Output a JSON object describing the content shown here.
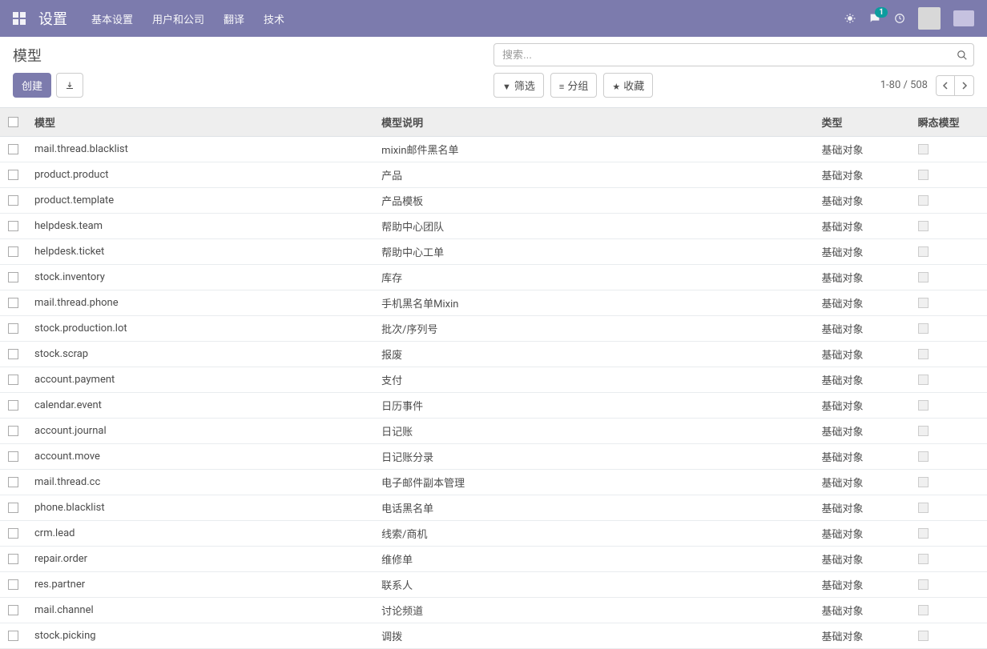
{
  "nav": {
    "title": "设置",
    "menu": [
      "基本设置",
      "用户和公司",
      "翻译",
      "技术"
    ],
    "msg_badge": "1"
  },
  "breadcrumb": "模型",
  "search": {
    "placeholder": "搜索..."
  },
  "buttons": {
    "create": "创建",
    "filter": "筛选",
    "group": "分组",
    "favorite": "收藏"
  },
  "pager": {
    "range": "1-80 / 508"
  },
  "table": {
    "headers": {
      "model": "模型",
      "desc": "模型说明",
      "type": "类型",
      "transient": "瞬态模型"
    },
    "rows": [
      {
        "model": "mail.thread.blacklist",
        "desc": "mixin邮件黑名单",
        "type": "基础对象"
      },
      {
        "model": "product.product",
        "desc": "产品",
        "type": "基础对象"
      },
      {
        "model": "product.template",
        "desc": "产品模板",
        "type": "基础对象"
      },
      {
        "model": "helpdesk.team",
        "desc": "帮助中心团队",
        "type": "基础对象"
      },
      {
        "model": "helpdesk.ticket",
        "desc": "帮助中心工单",
        "type": "基础对象"
      },
      {
        "model": "stock.inventory",
        "desc": "库存",
        "type": "基础对象"
      },
      {
        "model": "mail.thread.phone",
        "desc": "手机黑名单Mixin",
        "type": "基础对象"
      },
      {
        "model": "stock.production.lot",
        "desc": "批次/序列号",
        "type": "基础对象"
      },
      {
        "model": "stock.scrap",
        "desc": "报废",
        "type": "基础对象"
      },
      {
        "model": "account.payment",
        "desc": "支付",
        "type": "基础对象"
      },
      {
        "model": "calendar.event",
        "desc": "日历事件",
        "type": "基础对象"
      },
      {
        "model": "account.journal",
        "desc": "日记账",
        "type": "基础对象"
      },
      {
        "model": "account.move",
        "desc": "日记账分录",
        "type": "基础对象"
      },
      {
        "model": "mail.thread.cc",
        "desc": "电子邮件副本管理",
        "type": "基础对象"
      },
      {
        "model": "phone.blacklist",
        "desc": "电话黑名单",
        "type": "基础对象"
      },
      {
        "model": "crm.lead",
        "desc": "线索/商机",
        "type": "基础对象"
      },
      {
        "model": "repair.order",
        "desc": "维修单",
        "type": "基础对象"
      },
      {
        "model": "res.partner",
        "desc": "联系人",
        "type": "基础对象"
      },
      {
        "model": "mail.channel",
        "desc": "讨论频道",
        "type": "基础对象"
      },
      {
        "model": "stock.picking",
        "desc": "调拨",
        "type": "基础对象"
      }
    ]
  }
}
